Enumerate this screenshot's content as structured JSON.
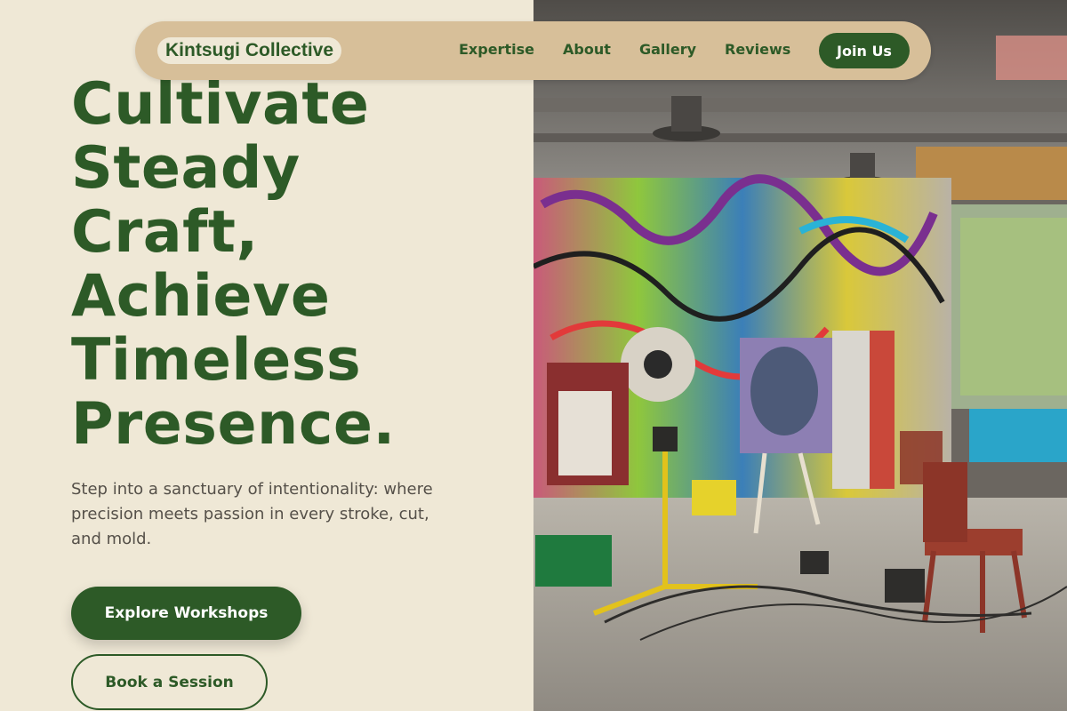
{
  "nav": {
    "brand": "Kintsugi Collective",
    "links": [
      "Expertise",
      "About",
      "Gallery",
      "Reviews"
    ],
    "cta": "Join Us"
  },
  "hero": {
    "headline_lines": [
      "Cultivate",
      "Steady",
      "Craft,",
      "Achieve",
      "Timeless",
      "Presence."
    ],
    "subtext": "Step into a sanctuary of intentionality: where precision meets passion in every stroke, cut, and mold.",
    "primary_cta": "Explore Workshops",
    "secondary_cta": "Book a Session"
  },
  "colors": {
    "accent": "#2d5a27",
    "background": "#efe8d6",
    "nav_background": "#d7bf99",
    "body_text": "#555049"
  }
}
